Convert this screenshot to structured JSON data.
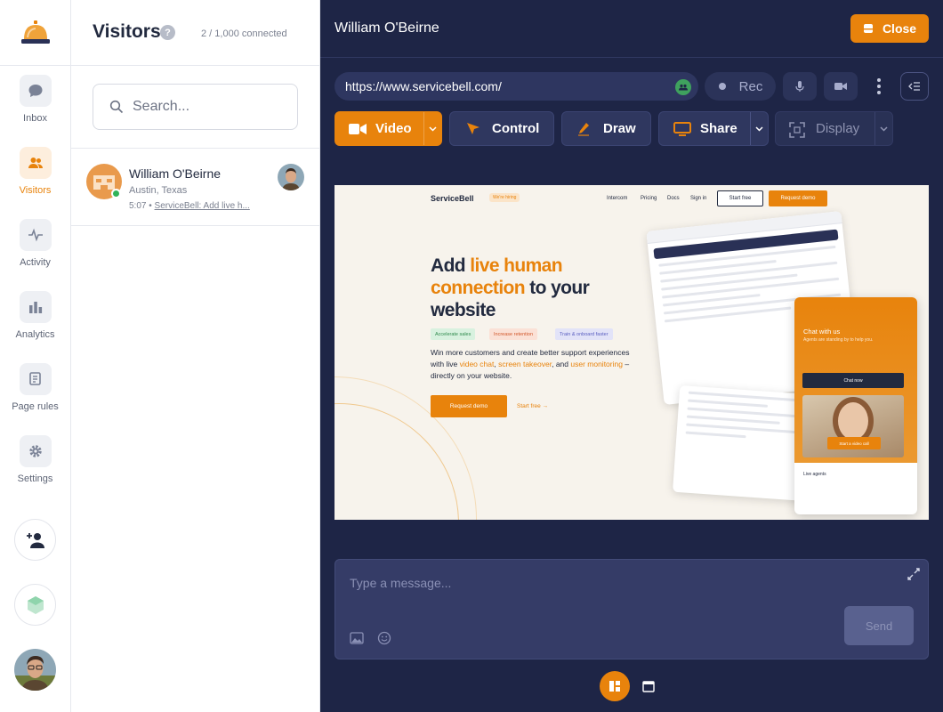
{
  "nav": {
    "items": [
      {
        "label": "Inbox",
        "icon": "chat-bubble-icon"
      },
      {
        "label": "Visitors",
        "icon": "users-icon"
      },
      {
        "label": "Activity",
        "icon": "activity-icon"
      },
      {
        "label": "Analytics",
        "icon": "bar-chart-icon"
      },
      {
        "label": "Page rules",
        "icon": "scroll-icon"
      },
      {
        "label": "Settings",
        "icon": "gear-icon"
      }
    ],
    "active": "Visitors"
  },
  "visitors_panel": {
    "title": "Visitors",
    "help": "?",
    "count": "2 / 1,000 connected",
    "search_placeholder": "Search...",
    "visitors": [
      {
        "name": "William O'Beirne",
        "location": "Austin, Texas",
        "time": "5:07",
        "page": "ServiceBell: Add live h...",
        "online": true
      }
    ]
  },
  "session": {
    "title": "William O'Beirne",
    "close_label": "Close",
    "url": "https://www.servicebell.com/",
    "rec_label": "Rec",
    "actions": {
      "video": "Video",
      "control": "Control",
      "draw": "Draw",
      "share": "Share",
      "display": "Display"
    }
  },
  "preview": {
    "logo": "ServiceBell",
    "hiring": "We're hiring",
    "nav_links": [
      "Intercom",
      "Pricing",
      "Docs",
      "Sign in"
    ],
    "start_free": "Start free",
    "request_demo": "Request demo",
    "headline_parts": [
      "Add ",
      "live human connection",
      " to your website"
    ],
    "tags": [
      "Accelerate sales",
      "Increase retention",
      "Train & onboard faster"
    ],
    "body_parts": [
      "Win more customers and create better support experiences with live ",
      "video chat",
      ", ",
      "screen takeover",
      ", and ",
      "user monitoring",
      " – directly on your website."
    ],
    "cta": "Request demo",
    "start_link": "Start free →",
    "widget": {
      "title": "Chat with us",
      "subtitle": "Agents are standing by to help you.",
      "chat_now": "Chat now",
      "video_call": "Start a video call",
      "live_agents": "Live agents"
    }
  },
  "composer": {
    "placeholder": "Type a message...",
    "send_label": "Send"
  },
  "colors": {
    "accent": "#e8830c",
    "dark_bg": "#1e2546",
    "online": "#31b45a"
  }
}
